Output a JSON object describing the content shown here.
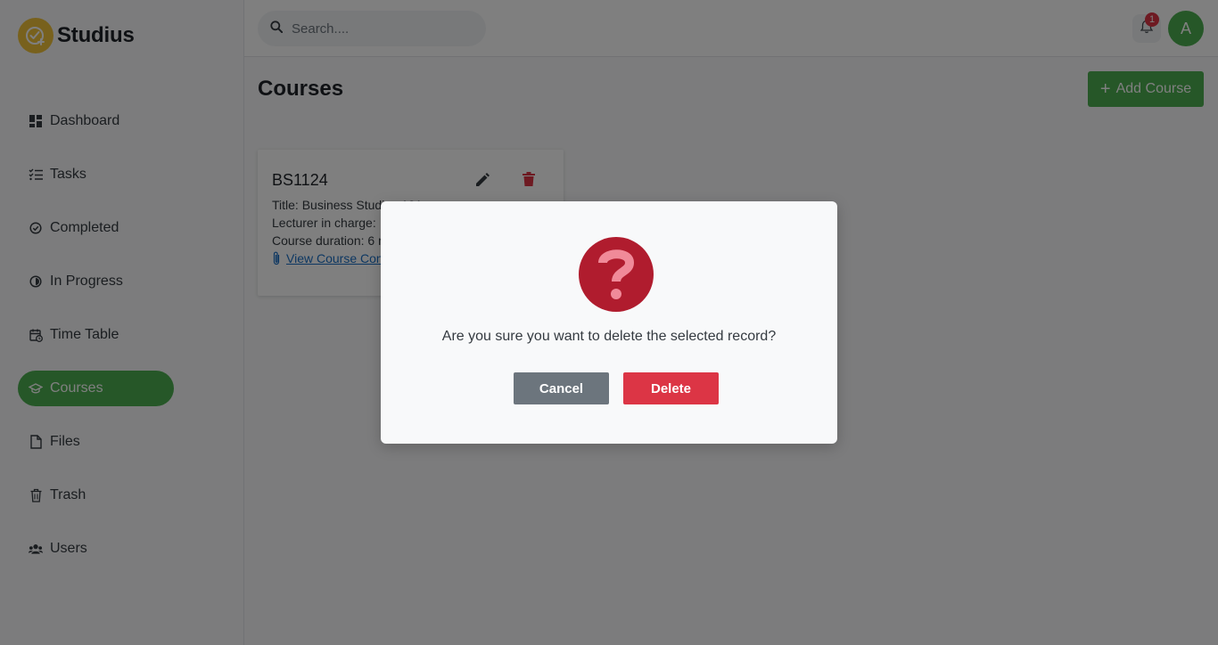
{
  "app": {
    "name": "Studius"
  },
  "sidebar": {
    "items": [
      {
        "label": "Dashboard",
        "icon": "dashboard-icon",
        "active": false
      },
      {
        "label": "Tasks",
        "icon": "tasks-icon",
        "active": false
      },
      {
        "label": "Completed",
        "icon": "check-circle-icon",
        "active": false
      },
      {
        "label": "In Progress",
        "icon": "progress-icon",
        "active": false
      },
      {
        "label": "Time Table",
        "icon": "calendar-clock-icon",
        "active": false
      },
      {
        "label": "Courses",
        "icon": "graduation-cap-icon",
        "active": true
      },
      {
        "label": "Files",
        "icon": "file-icon",
        "active": false
      },
      {
        "label": "Trash",
        "icon": "trash-icon",
        "active": false
      },
      {
        "label": "Users",
        "icon": "users-icon",
        "active": false
      }
    ]
  },
  "header": {
    "search_placeholder": "Search....",
    "notification_count": "1",
    "avatar_initial": "A"
  },
  "main": {
    "title": "Courses",
    "add_button_label": "Add Course",
    "courses": [
      {
        "code": "BS1124",
        "title_line": "Title: Business Studies 101",
        "lecturer_line": "Lecturer in charge: ",
        "duration_line": "Course duration: 6 months",
        "link_label": "View Course Content"
      }
    ]
  },
  "modal": {
    "message": "Are you sure you want to delete the selected record?",
    "cancel_label": "Cancel",
    "delete_label": "Delete"
  },
  "colors": {
    "accent": "#4caf50",
    "danger": "#dc3545",
    "modal_icon": "#b01c2e",
    "secondary": "#6c757d",
    "logo": "#f0c23b"
  }
}
